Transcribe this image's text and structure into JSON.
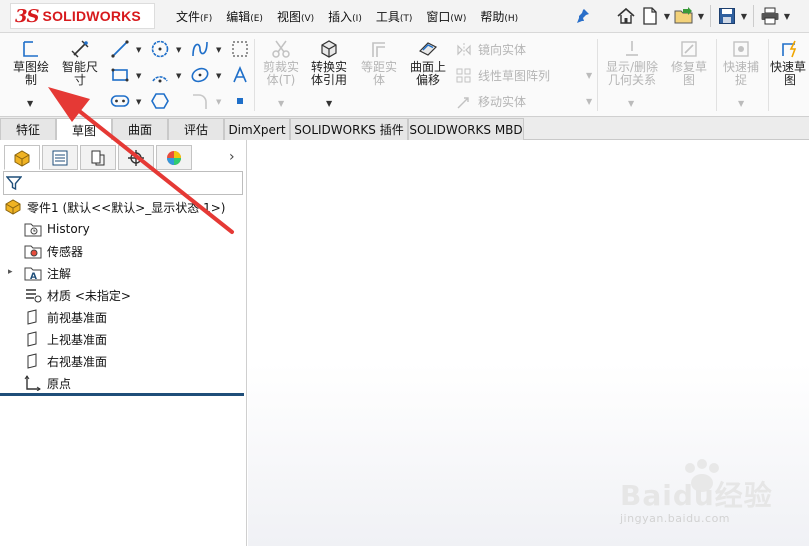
{
  "app": {
    "logo_ds": "3S",
    "logo_name": "SOLIDWORKS",
    "brand_color": "#d7191c"
  },
  "menu": {
    "items": [
      {
        "label": "文件",
        "accel": "(F)"
      },
      {
        "label": "编辑",
        "accel": "(E)"
      },
      {
        "label": "视图",
        "accel": "(V)"
      },
      {
        "label": "插入",
        "accel": "(I)"
      },
      {
        "label": "工具",
        "accel": "(T)"
      },
      {
        "label": "窗口",
        "accel": "(W)"
      },
      {
        "label": "帮助",
        "accel": "(H)"
      }
    ]
  },
  "quick_access": [
    "home-icon",
    "new-document-icon",
    "open-folder-icon",
    "save-icon",
    "print-icon"
  ],
  "ribbon": {
    "sketch_line1": "草图绘",
    "sketch_line2": "制",
    "smart_dim_line1": "智能尺",
    "smart_dim_line2": "寸",
    "trim_line1": "剪裁实",
    "trim_line2": "体(T)",
    "convert_line1": "转换实",
    "convert_line2": "体引用",
    "offset_entity_line1": "等距实",
    "offset_entity_line2": "体",
    "offset_surface_line1": "曲面上",
    "offset_surface_line2": "偏移",
    "mirror": "镜向实体",
    "linear_pattern": "线性草图阵列",
    "move": "移动实体",
    "display_relations_line1": "显示/删除",
    "display_relations_line2": "几何关系",
    "repair_line1": "修复草",
    "repair_line2": "图",
    "rapid_snap_line1": "快速捕",
    "rapid_snap_line2": "捉",
    "rapid_sketch_line1": "快速草",
    "rapid_sketch_line2": "图"
  },
  "tabs": [
    {
      "label": "特征",
      "active": false
    },
    {
      "label": "草图",
      "active": true
    },
    {
      "label": "曲面",
      "active": false
    },
    {
      "label": "评估",
      "active": false
    },
    {
      "label": "DimXpert",
      "active": false
    },
    {
      "label": "SOLIDWORKS 插件",
      "active": false
    },
    {
      "label": "SOLIDWORKS MBD",
      "active": false
    }
  ],
  "tree": {
    "part": "零件1  (默认<<默认>_显示状态 1>)",
    "history": "History",
    "sensors": "传感器",
    "annotations": "注解",
    "material": "材质 <未指定>",
    "front_plane": "前视基准面",
    "top_plane": "上视基准面",
    "right_plane": "右视基准面",
    "origin": "原点"
  },
  "watermark": {
    "brand": "Baidu经验",
    "url": "jingyan.baidu.com"
  },
  "colors": {
    "accent_blue": "#1f4e79",
    "annotation_red": "#e53935",
    "part_yellow": "#f0b323"
  }
}
